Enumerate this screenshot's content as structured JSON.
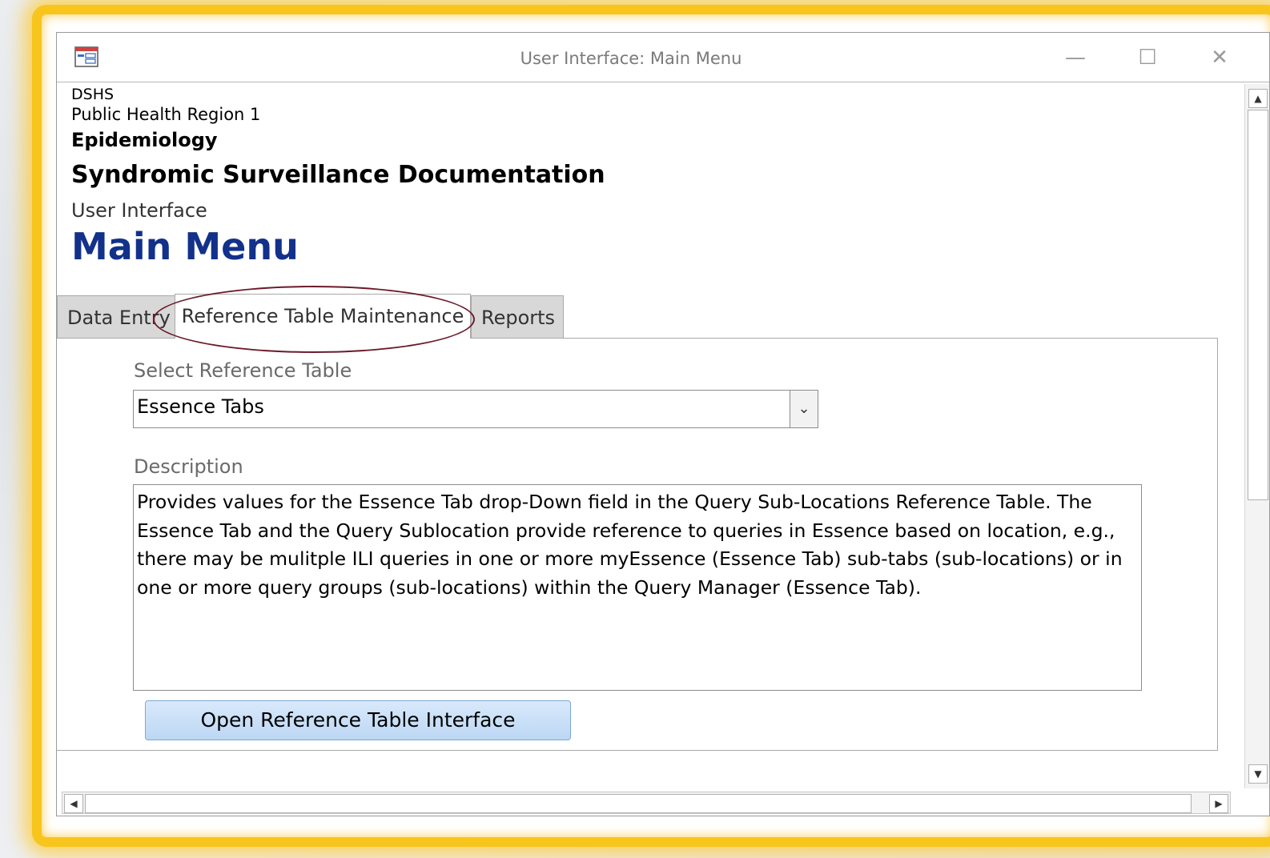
{
  "window": {
    "title": "User Interface: Main Menu",
    "minimize_label": "—",
    "maximize_label": "☐",
    "close_label": "✕"
  },
  "header": {
    "org": "DSHS",
    "region": "Public Health Region 1",
    "department": "Epidemiology",
    "system": "Syndromic Surveillance Documentation",
    "section": "User Interface",
    "page_title": "Main Menu"
  },
  "tabs": [
    {
      "label": "Data Entry",
      "active": false
    },
    {
      "label": "Reference Table Maintenance",
      "active": true
    },
    {
      "label": "Reports",
      "active": false
    }
  ],
  "reference_panel": {
    "select_label": "Select Reference Table",
    "select_value": "Essence Tabs",
    "description_label": "Description",
    "description_text": "Provides values for the Essence Tab drop-Down field in the Query Sub-Locations Reference Table. The Essence Tab and the Query Sublocation provide reference to queries in Essence based on location, e.g., there may be mulitple ILI queries in one or more myEssence (Essence Tab) sub-tabs (sub-locations) or in one or more query groups (sub-locations) within the Query Manager (Essence Tab).",
    "open_button_label": "Open Reference Table Interface"
  },
  "colors": {
    "highlight_frame": "#f7c51c",
    "page_title": "#12318b",
    "annotation_ellipse": "#6b1b2a",
    "button_fill": "#c9dff7"
  }
}
